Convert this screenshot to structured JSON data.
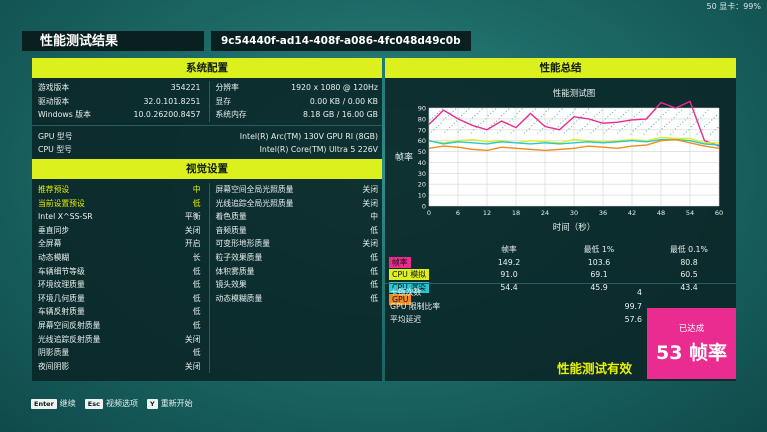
{
  "top_fps": "50 显卡：99%",
  "header": {
    "title": "性能测试结果",
    "guid": "9c54440f-ad14-408f-a086-4fc048d49c0b"
  },
  "system": {
    "heading": "系统配置",
    "left": [
      {
        "k": "游戏版本",
        "v": "354221"
      },
      {
        "k": "驱动版本",
        "v": "32.0.101.8251"
      },
      {
        "k": "Windows 版本",
        "v": "10.0.26200.8457"
      }
    ],
    "right": [
      {
        "k": "分辨率",
        "v": "1920 x 1080 @ 120Hz"
      },
      {
        "k": "显存",
        "v": "0.00 KB / 0.00 KB"
      },
      {
        "k": "系统内存",
        "v": "8.18 GB / 16.00 GB"
      }
    ],
    "gpu": {
      "k": "GPU 型号",
      "v": "Intel(R) Arc(TM) 130V GPU RI (8GB)"
    },
    "cpu": {
      "k": "CPU 型号",
      "v": "Intel(R) Core(TM) Ultra 5 226V"
    }
  },
  "visual": {
    "heading": "视觉设置",
    "left": [
      {
        "k": "推荐预设",
        "v": "中"
      },
      {
        "k": "当前设置预设",
        "v": "低"
      },
      {
        "k": "Intel X^SS-SR",
        "v": "平衡"
      },
      {
        "k": "垂直同步",
        "v": "关闭"
      },
      {
        "k": "全屏幕",
        "v": "开启"
      },
      {
        "k": "动态模糊",
        "v": "长"
      },
      {
        "k": "车辆细节等级",
        "v": "低"
      },
      {
        "k": "环境纹理质量",
        "v": "低"
      },
      {
        "k": "环境几何质量",
        "v": "低"
      },
      {
        "k": "车辆反射质量",
        "v": "低"
      },
      {
        "k": "屏幕空间反射质量",
        "v": "低"
      },
      {
        "k": "光线追踪反射质量",
        "v": "关闭"
      },
      {
        "k": "阴影质量",
        "v": "低"
      },
      {
        "k": "夜间阴影",
        "v": "关闭"
      }
    ],
    "right": [
      {
        "k": "屏幕空间全局光照质量",
        "v": "关闭"
      },
      {
        "k": "光线追踪全局光照质量",
        "v": "关闭"
      },
      {
        "k": "着色质量",
        "v": "中"
      },
      {
        "k": "音频质量",
        "v": "低"
      },
      {
        "k": "可变形地形质量",
        "v": "关闭"
      },
      {
        "k": "粒子效果质量",
        "v": "低"
      },
      {
        "k": "体积雾质量",
        "v": "低"
      },
      {
        "k": "镜头效果",
        "v": "低"
      },
      {
        "k": "动态模糊质量",
        "v": "低"
      }
    ]
  },
  "perf": {
    "heading": "性能总结",
    "chart_title": "性能测试图",
    "ylabel": "帧率",
    "xlabel": "时间（秒）",
    "stats_headers": [
      "帧率",
      "最低 1%",
      "最低 0.1%"
    ],
    "stats": [
      {
        "label": "帧率",
        "color": "#ea2b90",
        "values": [
          "149.2",
          "103.6",
          "80.8"
        ]
      },
      {
        "label": "CPU 模拟",
        "color": "#dcf01e",
        "values": [
          "91.0",
          "69.1",
          "60.5"
        ]
      },
      {
        "label": "CPU 渲染",
        "color": "#27c7d6",
        "values": [
          "54.4",
          "45.9",
          "43.4"
        ]
      },
      {
        "label": "GPU",
        "color": "#f28c22",
        "values": [
          "",
          "",
          ""
        ]
      }
    ],
    "summary": [
      {
        "k": "卡顿次数",
        "v": "4"
      },
      {
        "k": "GPU 限制比率",
        "v": "99.7"
      },
      {
        "k": "平均延迟",
        "v": "57.6"
      }
    ],
    "valid_text": "性能测试有效",
    "achieved_label": "已达成",
    "achieved_value": "53 帧率"
  },
  "chart_data": {
    "type": "line",
    "title": "性能测试图",
    "xlabel": "时间（秒）",
    "ylabel": "帧率",
    "xlim": [
      0,
      60
    ],
    "ylim": [
      0,
      90
    ],
    "xticks": [
      0,
      6,
      12,
      18,
      24,
      30,
      36,
      42,
      48,
      54,
      60
    ],
    "yticks": [
      0,
      10,
      20,
      30,
      40,
      50,
      60,
      70,
      80,
      90
    ],
    "series": [
      {
        "name": "帧率",
        "color": "#ea2b90",
        "x": [
          0,
          3,
          6,
          9,
          12,
          15,
          18,
          21,
          24,
          27,
          30,
          33,
          36,
          39,
          42,
          45,
          48,
          51,
          54,
          57,
          60
        ],
        "y": [
          75,
          88,
          80,
          74,
          70,
          78,
          72,
          85,
          73,
          70,
          82,
          80,
          76,
          77,
          79,
          80,
          95,
          90,
          96,
          60,
          55
        ]
      },
      {
        "name": "CPU 模拟",
        "color": "#dcf01e",
        "x": [
          0,
          3,
          6,
          9,
          12,
          15,
          18,
          21,
          24,
          27,
          30,
          33,
          36,
          39,
          42,
          45,
          48,
          51,
          54,
          57,
          60
        ],
        "y": [
          60,
          58,
          60,
          61,
          59,
          60,
          58,
          60,
          59,
          58,
          61,
          60,
          59,
          60,
          61,
          60,
          63,
          62,
          62,
          58,
          58
        ]
      },
      {
        "name": "CPU 渲染",
        "color": "#27c7d6",
        "x": [
          0,
          3,
          6,
          9,
          12,
          15,
          18,
          21,
          24,
          27,
          30,
          33,
          36,
          39,
          42,
          45,
          48,
          51,
          54,
          57,
          60
        ],
        "y": [
          60,
          57,
          59,
          58,
          57,
          59,
          58,
          57,
          58,
          57,
          58,
          59,
          58,
          59,
          60,
          59,
          61,
          61,
          60,
          57,
          56
        ]
      },
      {
        "name": "GPU",
        "color": "#f28c22",
        "x": [
          0,
          3,
          6,
          9,
          12,
          15,
          18,
          21,
          24,
          27,
          30,
          33,
          36,
          39,
          42,
          45,
          48,
          51,
          54,
          57,
          60
        ],
        "y": [
          53,
          55,
          54,
          52,
          51,
          54,
          53,
          52,
          51,
          52,
          53,
          55,
          54,
          53,
          55,
          56,
          60,
          61,
          58,
          55,
          53
        ]
      }
    ]
  },
  "footer": [
    {
      "key": "Enter",
      "label": "继续"
    },
    {
      "key": "Esc",
      "label": "视频选项"
    },
    {
      "key": "Y",
      "label": "重新开始"
    }
  ]
}
